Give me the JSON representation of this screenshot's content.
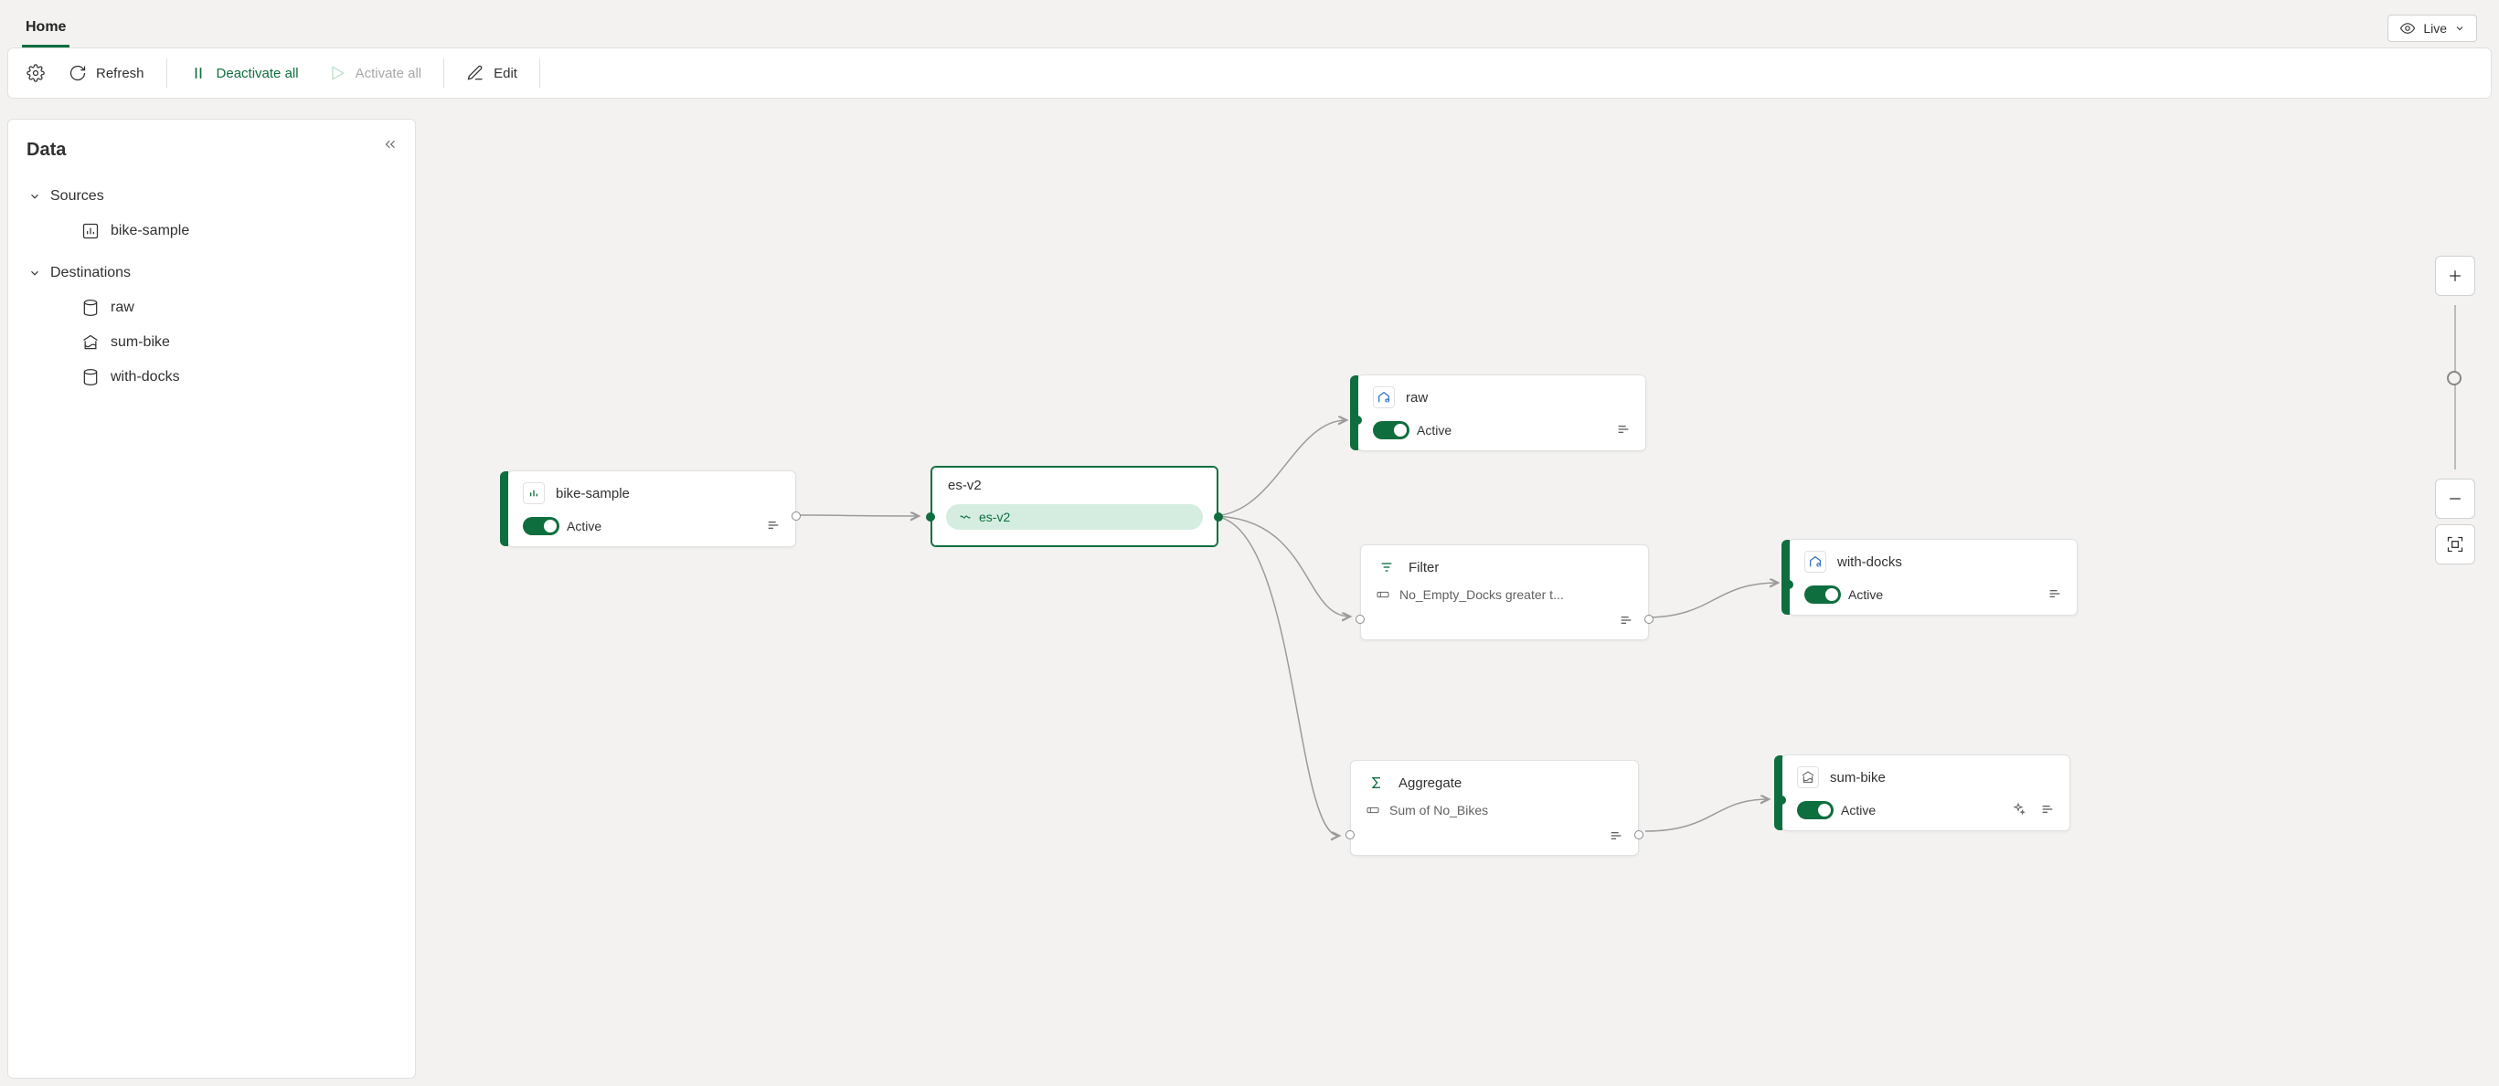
{
  "tabs": {
    "home": "Home"
  },
  "live_button": "Live",
  "toolbar": {
    "refresh": "Refresh",
    "deactivate_all": "Deactivate all",
    "activate_all": "Activate all",
    "edit": "Edit"
  },
  "side": {
    "title": "Data",
    "sources_header": "Sources",
    "destinations_header": "Destinations",
    "sources": [
      {
        "label": "bike-sample"
      }
    ],
    "destinations": [
      {
        "label": "raw"
      },
      {
        "label": "sum-bike"
      },
      {
        "label": "with-docks"
      }
    ]
  },
  "nodes": {
    "bike_sample": {
      "title": "bike-sample",
      "status": "Active"
    },
    "es_v2": {
      "title": "es-v2",
      "pill": "es-v2"
    },
    "raw": {
      "title": "raw",
      "status": "Active"
    },
    "filter": {
      "title": "Filter",
      "detail": "No_Empty_Docks greater t..."
    },
    "aggregate": {
      "title": "Aggregate",
      "detail": "Sum of No_Bikes"
    },
    "with_docks": {
      "title": "with-docks",
      "status": "Active"
    },
    "sum_bike": {
      "title": "sum-bike",
      "status": "Active"
    }
  }
}
